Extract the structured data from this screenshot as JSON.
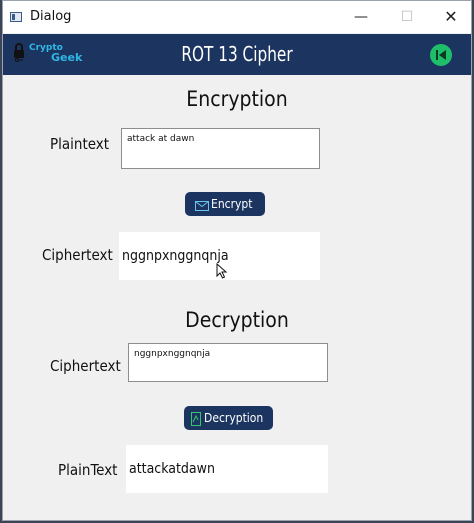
{
  "window": {
    "title": "Dialog"
  },
  "header": {
    "logo_line1": "Crypto",
    "logo_line2": "Geek",
    "title": "ROT 13 Cipher"
  },
  "encryption": {
    "section_title": "Encryption",
    "plaintext_label": "Plaintext",
    "plaintext_value": "attack at dawn",
    "button_label": "Encrypt",
    "ciphertext_label": "Ciphertext",
    "ciphertext_value": "nggnpxnggnqnja"
  },
  "decryption": {
    "section_title": "Decryption",
    "ciphertext_label": "Ciphertext",
    "ciphertext_value": "nggnpxnggnqnja",
    "button_label": "Decryption",
    "plaintext_label": "PlainText",
    "plaintext_value": "attackatdawn"
  },
  "icons": {
    "lock": "lock-icon",
    "exit": "exit-icon",
    "encrypt": "envelope-icon",
    "decrypt": "document-icon"
  },
  "colors": {
    "header_bg": "#1c3560",
    "accent": "#2fb6e6",
    "exit_button": "#1fbf6a",
    "button_bg": "#1c3560"
  }
}
